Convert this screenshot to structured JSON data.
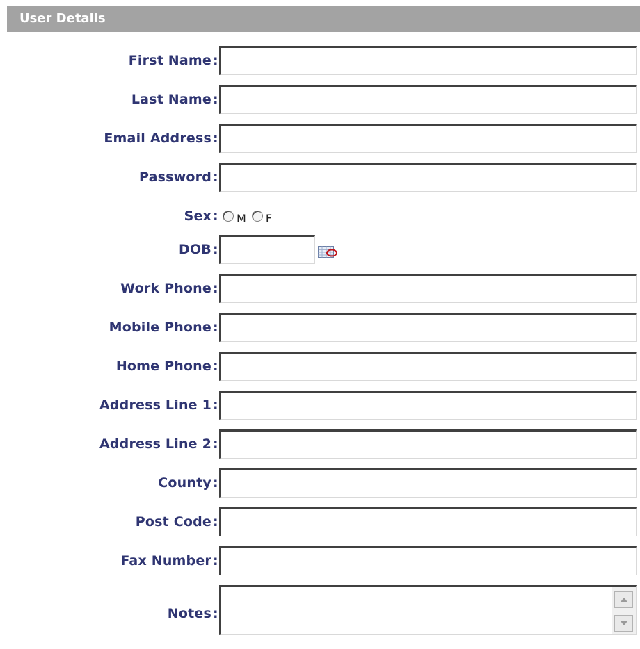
{
  "header": {
    "title": "User Details"
  },
  "colon": ":",
  "fields": {
    "first_name": {
      "label": "First Name",
      "value": ""
    },
    "last_name": {
      "label": "Last Name",
      "value": ""
    },
    "email": {
      "label": "Email Address",
      "value": ""
    },
    "password": {
      "label": "Password",
      "value": ""
    },
    "sex": {
      "label": "Sex",
      "options": [
        "M",
        "F"
      ],
      "selected": ""
    },
    "dob": {
      "label": "DOB",
      "value": "",
      "icon": "calendar-icon"
    },
    "work_phone": {
      "label": "Work Phone",
      "value": ""
    },
    "mobile_phone": {
      "label": "Mobile Phone",
      "value": ""
    },
    "home_phone": {
      "label": "Home Phone",
      "value": ""
    },
    "address1": {
      "label": "Address Line 1",
      "value": ""
    },
    "address2": {
      "label": "Address Line 2",
      "value": ""
    },
    "county": {
      "label": "County",
      "value": ""
    },
    "post_code": {
      "label": "Post Code",
      "value": ""
    },
    "fax": {
      "label": "Fax Number",
      "value": ""
    },
    "notes": {
      "label": "Notes",
      "value": ""
    }
  },
  "colors": {
    "header_bg": "#a3a3a3",
    "label_text": "#2f3572"
  }
}
